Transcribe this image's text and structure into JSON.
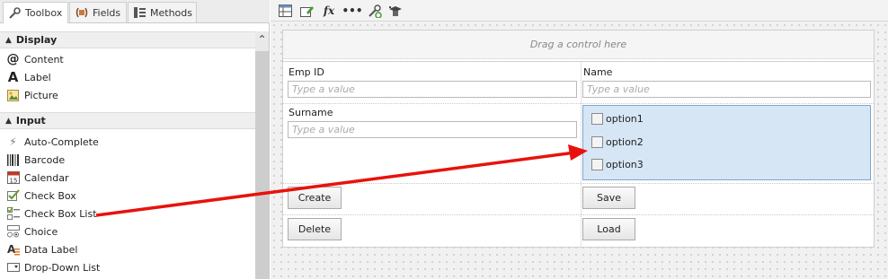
{
  "tabs": [
    {
      "label": "Toolbox",
      "icon": "wrench-icon"
    },
    {
      "label": "Fields",
      "icon": "fields-icon"
    },
    {
      "label": "Methods",
      "icon": "methods-icon"
    }
  ],
  "sections": {
    "display": {
      "label": "Display",
      "items": [
        {
          "label": "Content",
          "icon": "at-icon"
        },
        {
          "label": "Label",
          "icon": "label-a-icon"
        },
        {
          "label": "Picture",
          "icon": "picture-icon"
        }
      ]
    },
    "input": {
      "label": "Input",
      "items": [
        {
          "label": "Auto-Complete",
          "icon": "lightning-icon"
        },
        {
          "label": "Barcode",
          "icon": "barcode-icon"
        },
        {
          "label": "Calendar",
          "icon": "calendar-icon"
        },
        {
          "label": "Check Box",
          "icon": "checkmark-icon"
        },
        {
          "label": "Check Box List",
          "icon": "checkbox-list-icon"
        },
        {
          "label": "Choice",
          "icon": "choice-icon"
        },
        {
          "label": "Data Label",
          "icon": "data-label-icon"
        },
        {
          "label": "Drop-Down List",
          "icon": "dropdown-icon"
        }
      ]
    }
  },
  "canvas": {
    "dropzone": "Drag a control here",
    "fields": {
      "emp_id": {
        "label": "Emp ID",
        "placeholder": "Type a value"
      },
      "name": {
        "label": "Name",
        "placeholder": "Type a value"
      },
      "surname": {
        "label": "Surname",
        "placeholder": "Type a value"
      }
    },
    "options": [
      "option1",
      "option2",
      "option3"
    ],
    "buttons": {
      "create": "Create",
      "save": "Save",
      "delete": "Delete",
      "load": "Load"
    }
  },
  "colors": {
    "arrow": "#e8120c",
    "selection": "#d6e6f5"
  }
}
